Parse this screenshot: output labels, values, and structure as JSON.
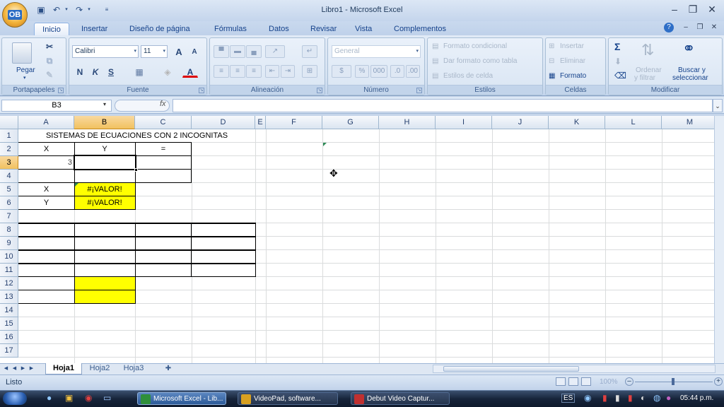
{
  "window": {
    "title": "Libro1 - Microsoft Excel"
  },
  "office_button": {
    "label": "OB"
  },
  "tabs": [
    "Inicio",
    "Insertar",
    "Diseño de página",
    "Fórmulas",
    "Datos",
    "Revisar",
    "Vista",
    "Complementos"
  ],
  "ribbon": {
    "clipboard": {
      "paste": "Pegar",
      "title": "Portapapeles"
    },
    "font": {
      "name": "Calibri",
      "size": "11",
      "bold": "N",
      "italic": "K",
      "underline": "S",
      "grow": "A",
      "shrink": "A",
      "color": "A",
      "title": "Fuente"
    },
    "alignment": {
      "title": "Alineación"
    },
    "number": {
      "format": "General",
      "percent": "%",
      "thousands": "000",
      "title": "Número"
    },
    "styles": {
      "conditional": "Formato condicional",
      "table": "Dar formato como tabla",
      "cell_styles": "Estilos de celda",
      "title": "Estilos"
    },
    "cells": {
      "insert": "Insertar",
      "delete": "Eliminar",
      "format": "Formato",
      "title": "Celdas"
    },
    "editing": {
      "sigma": "Σ",
      "sort": "Ordenar",
      "sort2": "y filtrar",
      "find": "Buscar y",
      "find2": "seleccionar",
      "title": "Modificar"
    }
  },
  "formula_bar": {
    "name_box": "B3",
    "fx": "fx",
    "content": ""
  },
  "columns": [
    "A",
    "B",
    "C",
    "D",
    "E",
    "F",
    "G",
    "H",
    "I",
    "J",
    "K",
    "L",
    "M"
  ],
  "rows": [
    "1",
    "2",
    "3",
    "4",
    "5",
    "6",
    "7",
    "8",
    "9",
    "10",
    "11",
    "12",
    "13",
    "14",
    "15",
    "16",
    "17"
  ],
  "cells": {
    "A1": "SISTEMAS DE ECUACIONES CON 2 INCOGNITAS",
    "A2": "X",
    "B2": "Y",
    "C2": "=",
    "A3": "3",
    "A5": "X",
    "B5": "#¡VALOR!",
    "A6": "Y",
    "B6": "#¡VALOR!"
  },
  "sheets": [
    "Hoja1",
    "Hoja2",
    "Hoja3"
  ],
  "status": {
    "text": "Listo",
    "zoom": "100%"
  },
  "taskbar": {
    "items": [
      "Microsoft Excel - Lib...",
      "VideoPad, software...",
      "Debut Video Captur..."
    ],
    "lang": "ES",
    "clock": "05:44 p.m."
  },
  "colors": {
    "yellow": "#ffff00",
    "ribbon": "#dbe6f4",
    "taskbar": "#17243a"
  }
}
